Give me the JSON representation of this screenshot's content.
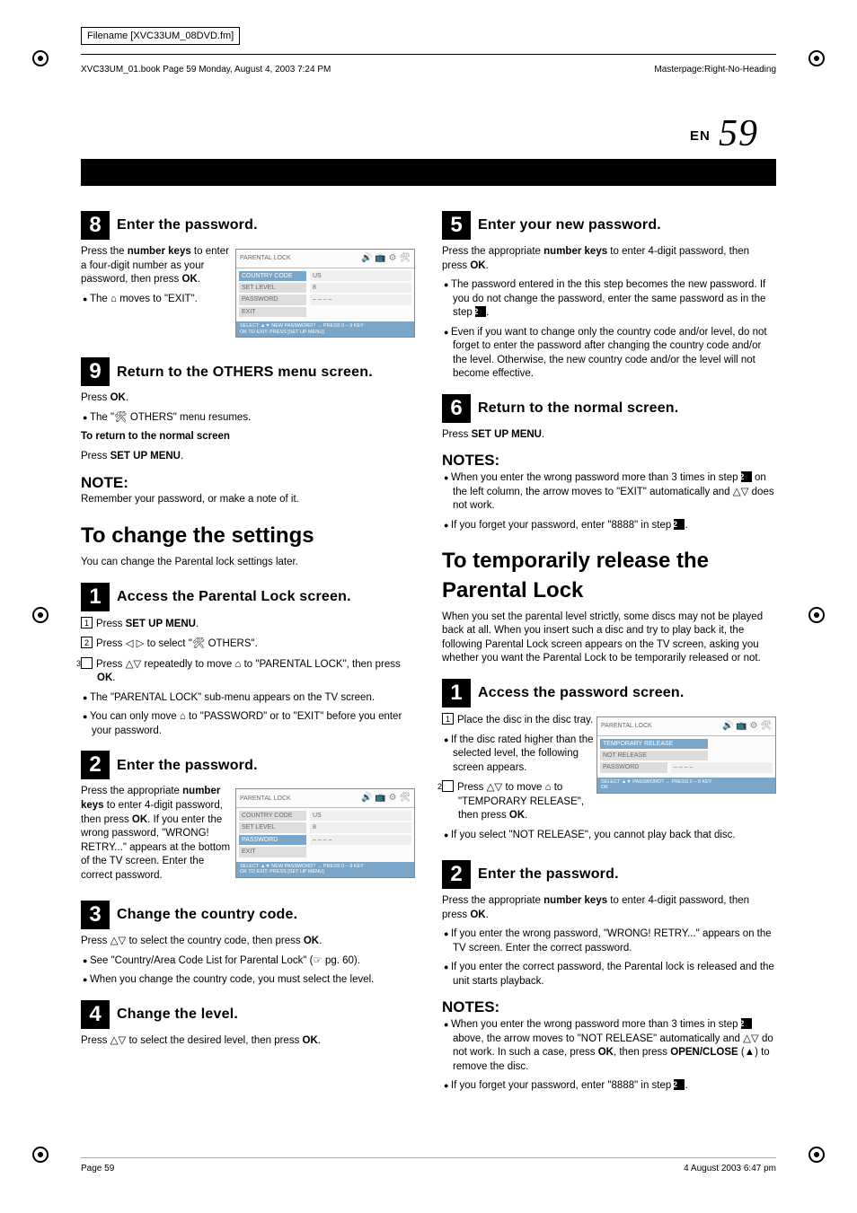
{
  "meta": {
    "filename_label": "Filename [XVC33UM_08DVD.fm]",
    "book_line": "XVC33UM_01.book  Page 59  Monday, August 4, 2003  7:24 PM",
    "masterpage": "Masterpage:Right-No-Heading",
    "page_en": "EN",
    "page_num": "59",
    "footer_left": "Page 59",
    "footer_right": "4 August 2003  6:47 pm"
  },
  "left": {
    "step8": {
      "num": "8",
      "title": "Enter the password.",
      "p1a": "Press the ",
      "p1b": "number keys",
      "p1c": " to enter a four-digit number as your password, then press ",
      "p1d": "OK",
      "p1e": ".",
      "b1": "The ⌂ moves to \"EXIT\"."
    },
    "step9": {
      "num": "9",
      "title": "Return to the OTHERS menu screen.",
      "p1a": "Press ",
      "p1b": "OK",
      "p1c": ".",
      "b1": "The \"🛠 OTHERS\" menu resumes.",
      "sub_title": "To return to the normal screen",
      "sub_p_a": "Press ",
      "sub_p_b": "SET UP MENU",
      "sub_p_c": ".",
      "note_h": "NOTE:",
      "note_p": "Remember your password, or make a note of it."
    },
    "sec1": {
      "title": "To change the settings",
      "intro": "You can change the Parental lock settings later."
    },
    "cstep1": {
      "num": "1",
      "title": "Access the Parental Lock screen.",
      "l1a": "Press ",
      "l1b": "SET UP MENU",
      "l1c": ".",
      "l2": "Press ◁ ▷ to select \"🛠 OTHERS\".",
      "l3a": "Press △▽ repeatedly to move ⌂ to \"PARENTAL LOCK\", then press ",
      "l3b": "OK",
      "l3c": ".",
      "b1": "The \"PARENTAL LOCK\" sub-menu appears on the TV screen.",
      "b2": "You can only move ⌂ to \"PASSWORD\" or to \"EXIT\" before you enter your password."
    },
    "cstep2": {
      "num": "2",
      "title": "Enter the password.",
      "p1a": "Press the appropriate ",
      "p1b": "number keys",
      "p1c": " to enter 4-digit password, then press ",
      "p1d": "OK",
      "p1e": ". If you enter the wrong password, \"WRONG! RETRY...\" appears at the bottom of the TV screen. Enter the correct password."
    },
    "cstep3": {
      "num": "3",
      "title": "Change the country code.",
      "p1a": "Press △▽ to select the country code, then press ",
      "p1b": "OK",
      "p1c": ".",
      "b1": "See \"Country/Area Code List for Parental Lock\" (☞ pg. 60).",
      "b2": "When you change the country code, you must select the level."
    },
    "cstep4": {
      "num": "4",
      "title": "Change the level.",
      "p1a": "Press △▽ to select the desired level, then press ",
      "p1b": "OK",
      "p1c": "."
    }
  },
  "right": {
    "step5": {
      "num": "5",
      "title": "Enter your new password.",
      "p1a": "Press the appropriate ",
      "p1b": "number keys",
      "p1c": " to enter 4-digit password, then press ",
      "p1d": "OK",
      "p1e": ".",
      "b1": "The password entered in the this step becomes the new password. If you do not change the password, enter the same password as in the step ",
      "b2": "Even if you want to change only the country code and/or level, do not forget to enter the password after changing the country code and/or the level. Otherwise, the new country code and/or the level will not become effective."
    },
    "step6": {
      "num": "6",
      "title": "Return to the normal screen.",
      "p1a": "Press ",
      "p1b": "SET UP MENU",
      "p1c": ".",
      "notes_h": "NOTES:",
      "nb1a": "When you enter the wrong password more than 3 times in step ",
      "nb1b": " on the left column, the arrow moves to \"EXIT\" automatically and △▽ does not work.",
      "nb2a": "If you forget your password, enter \"8888\" in step "
    },
    "sec2": {
      "title": "To temporarily release the Parental Lock",
      "intro": "When you set the parental level strictly, some discs may not be played back at all. When you insert such a disc and try to play back it, the following Parental Lock screen appears on the TV screen, asking you whether you want the Parental Lock to be temporarily released or not."
    },
    "tstep1": {
      "num": "1",
      "title": "Access the password screen.",
      "l1": "Place the disc in the disc tray.",
      "b1": "If the disc rated higher than the selected level, the following screen appears.",
      "l2a": "Press △▽ to move ⌂ to \"TEMPORARY RELEASE\", then press ",
      "l2b": "OK",
      "l2c": ".",
      "b2": "If you select \"NOT RELEASE\", you cannot play back that disc."
    },
    "tstep2": {
      "num": "2",
      "title": "Enter the password.",
      "p1a": "Press the appropriate ",
      "p1b": "number keys",
      "p1c": " to enter 4-digit password, then press ",
      "p1d": "OK",
      "p1e": ".",
      "b1": "If you enter the wrong password, \"WRONG! RETRY...\" appears on the TV screen. Enter the correct password.",
      "b2": "If you enter the correct password, the Parental lock is released and the unit starts playback.",
      "notes_h": "NOTES:",
      "nb1a": "When you enter the wrong password more than 3 times in step ",
      "nb1b": " above, the arrow moves to \"NOT RELEASE\" automatically and △▽ do not work. In such a case, press ",
      "nb1c": "OK",
      "nb1d": ", then press ",
      "nb1e": "OPEN/CLOSE",
      "nb1f": " (▲) to remove the disc.",
      "nb2a": "If you forget your password, enter \"8888\" in step "
    }
  },
  "tv": {
    "title": "PARENTAL LOCK",
    "rows1": [
      {
        "label": "COUNTRY CODE",
        "val": "US",
        "active": true
      },
      {
        "label": "SET LEVEL",
        "val": "8"
      },
      {
        "label": "PASSWORD",
        "val": "– – – –"
      },
      {
        "label": "EXIT",
        "val": ""
      }
    ],
    "footer1a": "SELECT   ▲▼   NEW PASSWORD? → PRESS 0 – 9 KEY",
    "footer1b": "OK            TO EXIT: PRESS [SET UP MENU]",
    "rows3": [
      {
        "label": "TEMPORARY RELEASE",
        "val": "",
        "active": true
      },
      {
        "label": "NOT RELEASE",
        "val": ""
      },
      {
        "label": "PASSWORD",
        "val": "– – – –"
      }
    ],
    "footer3a": "SELECT   ▲▼   PASSWORD? → PRESS 0 – 9 KEY",
    "footer3b": "OK"
  }
}
